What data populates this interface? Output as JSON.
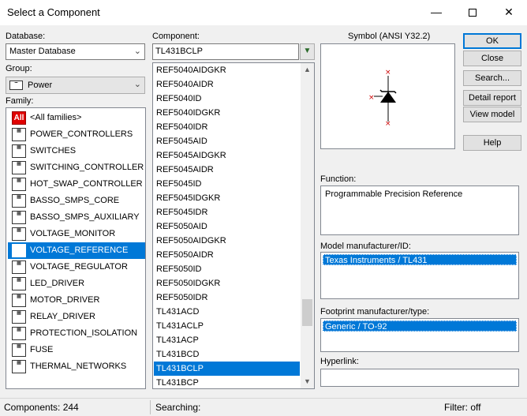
{
  "window": {
    "title": "Select a Component"
  },
  "database": {
    "label": "Database:",
    "value": "Master Database"
  },
  "group": {
    "label": "Group:",
    "value": "Power"
  },
  "family": {
    "label": "Family:",
    "items": [
      {
        "label": "<All families>",
        "icon": "all-families-icon"
      },
      {
        "label": "POWER_CONTROLLERS",
        "icon": "power-controllers-icon"
      },
      {
        "label": "SWITCHES",
        "icon": "switches-icon"
      },
      {
        "label": "SWITCHING_CONTROLLER",
        "icon": "switching-controller-icon"
      },
      {
        "label": "HOT_SWAP_CONTROLLER",
        "icon": "hot-swap-controller-icon"
      },
      {
        "label": "BASSO_SMPS_CORE",
        "icon": "basso-smps-core-icon"
      },
      {
        "label": "BASSO_SMPS_AUXILIARY",
        "icon": "basso-smps-auxiliary-icon"
      },
      {
        "label": "VOLTAGE_MONITOR",
        "icon": "voltage-monitor-icon"
      },
      {
        "label": "VOLTAGE_REFERENCE",
        "icon": "voltage-reference-icon"
      },
      {
        "label": "VOLTAGE_REGULATOR",
        "icon": "voltage-regulator-icon"
      },
      {
        "label": "LED_DRIVER",
        "icon": "led-driver-icon"
      },
      {
        "label": "MOTOR_DRIVER",
        "icon": "motor-driver-icon"
      },
      {
        "label": "RELAY_DRIVER",
        "icon": "relay-driver-icon"
      },
      {
        "label": "PROTECTION_ISOLATION",
        "icon": "protection-isolation-icon"
      },
      {
        "label": "FUSE",
        "icon": "fuse-icon"
      },
      {
        "label": "THERMAL_NETWORKS",
        "icon": "thermal-networks-icon"
      }
    ],
    "selected": "VOLTAGE_REFERENCE"
  },
  "component": {
    "label": "Component:",
    "value": "TL431BCLP",
    "items": [
      "REF5040AIDGKR",
      "REF5040AIDR",
      "REF5040ID",
      "REF5040IDGKR",
      "REF5040IDR",
      "REF5045AID",
      "REF5045AIDGKR",
      "REF5045AIDR",
      "REF5045ID",
      "REF5045IDGKR",
      "REF5045IDR",
      "REF5050AID",
      "REF5050AIDGKR",
      "REF5050AIDR",
      "REF5050ID",
      "REF5050IDGKR",
      "REF5050IDR",
      "TL431ACD",
      "TL431ACLP",
      "TL431ACP",
      "TL431BCD",
      "TL431BCLP",
      "TL431BCP"
    ],
    "selected": "TL431BCLP",
    "scroll_position": 0.82
  },
  "symbol": {
    "label": "Symbol (ANSI Y32.2)"
  },
  "buttons": {
    "ok": "OK",
    "close": "Close",
    "search": "Search...",
    "detail_report": "Detail report",
    "view_model": "View model",
    "help": "Help"
  },
  "function": {
    "label": "Function:",
    "value": "Programmable  Precision Reference"
  },
  "model": {
    "label": "Model manufacturer/ID:",
    "value": "Texas Instruments / TL431"
  },
  "footprint": {
    "label": "Footprint manufacturer/type:",
    "value": "Generic / TO-92"
  },
  "hyperlink": {
    "label": "Hyperlink:",
    "value": ""
  },
  "status": {
    "components": "Components: 244",
    "searching": "Searching:",
    "filter": "Filter: off"
  },
  "colors": {
    "selection": "#0078d7",
    "all_families_badge": "#e00000",
    "symbol_pins": "#cc0000"
  }
}
